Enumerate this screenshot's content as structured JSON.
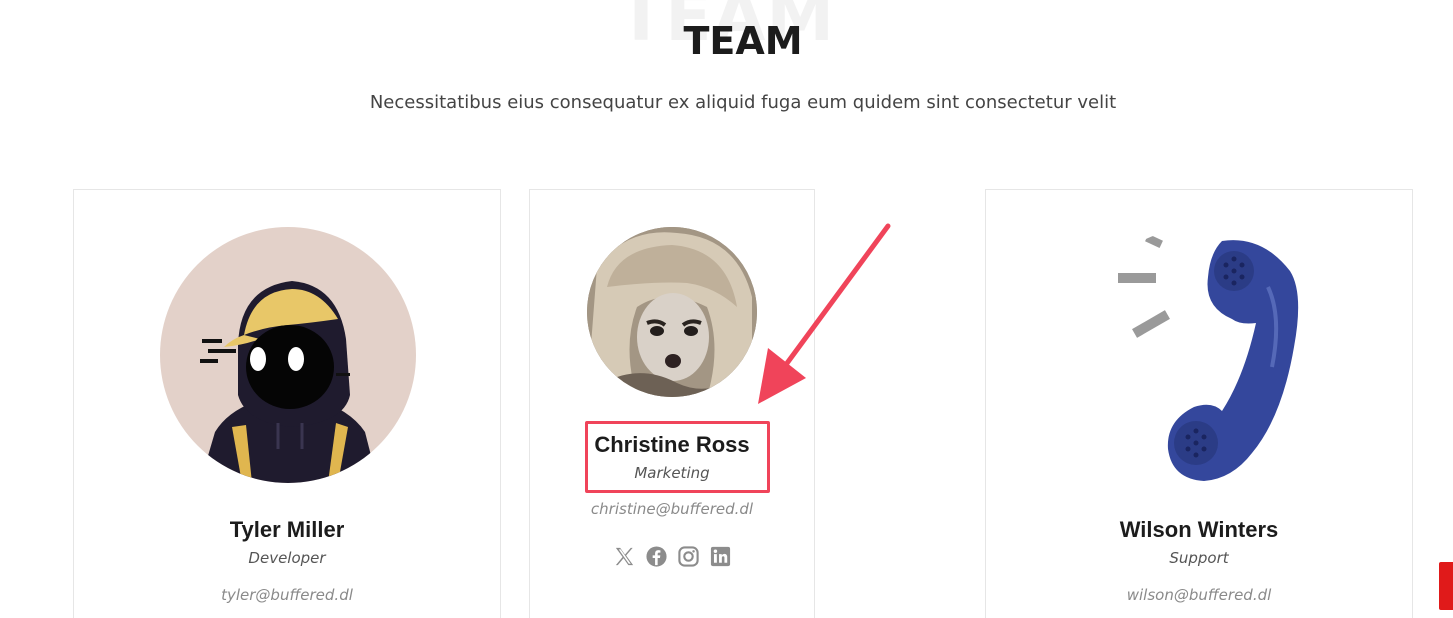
{
  "section": {
    "title": "TEAM",
    "subtitle": "Necessitatibus eius consequatur ex aliquid fuga eum quidem sint consectetur velit"
  },
  "members": [
    {
      "name": "Tyler Miller",
      "role": "Developer",
      "email": "tyler@buffered.dl"
    },
    {
      "name": "Christine Ross",
      "role": "Marketing",
      "email": "christine@buffered.dl"
    },
    {
      "name": "Wilson Winters",
      "role": "Support",
      "email": "wilson@buffered.dl"
    }
  ],
  "socials": [
    {
      "icon": "x-icon"
    },
    {
      "icon": "facebook-icon"
    },
    {
      "icon": "instagram-icon"
    },
    {
      "icon": "linkedin-icon"
    }
  ],
  "colors": {
    "highlight": "#f0445a",
    "accent": "#e01a1a",
    "social_icon": "#8c8c8c"
  }
}
